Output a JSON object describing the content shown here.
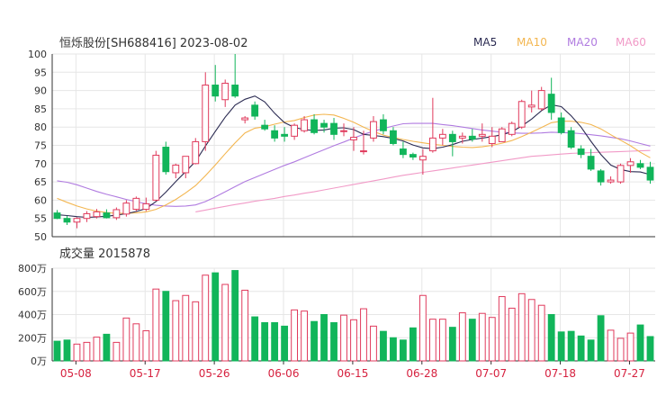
{
  "title": "恒烁股份[SH688416] 2023-08-02",
  "colors": {
    "up": "#e03a5c",
    "down": "#11b55a",
    "ma5": "#2b2b52",
    "ma10": "#f3b650",
    "ma20": "#b07be0",
    "ma60": "#f19ac7",
    "grid": "#e6e6e6",
    "axis_text": "#333333",
    "date_text": "#d6213f"
  },
  "legend": [
    {
      "name": "MA5",
      "color": "#2b2b52"
    },
    {
      "name": "MA10",
      "color": "#f3b650"
    },
    {
      "name": "MA20",
      "color": "#b07be0"
    },
    {
      "name": "MA60",
      "color": "#f19ac7"
    }
  ],
  "chart_data": [
    {
      "type": "candlestick",
      "yrange": [
        50,
        100
      ],
      "yticks": [
        "100",
        "95",
        "90",
        "85",
        "80",
        "75",
        "70",
        "65",
        "60",
        "55",
        "50"
      ],
      "x": [
        "05-08",
        "05-09",
        "05-10",
        "05-11",
        "05-12",
        "05-15",
        "05-16",
        "05-17",
        "05-18",
        "05-19",
        "05-22",
        "05-23",
        "05-24",
        "05-25",
        "05-26",
        "05-29",
        "05-30",
        "05-31",
        "06-01",
        "06-02",
        "06-05",
        "06-06",
        "06-07",
        "06-08",
        "06-09",
        "06-12",
        "06-13",
        "06-14",
        "06-15",
        "06-16",
        "06-19",
        "06-20",
        "06-21",
        "06-26",
        "06-27",
        "06-28",
        "06-29",
        "06-30",
        "07-03",
        "07-04",
        "07-05",
        "07-06",
        "07-07",
        "07-10",
        "07-11",
        "07-12",
        "07-13",
        "07-14",
        "07-17",
        "07-18",
        "07-19",
        "07-20",
        "07-21",
        "07-24",
        "07-25",
        "07-26",
        "07-27",
        "07-28",
        "07-31",
        "08-01",
        "08-02"
      ],
      "ohlc": [
        [
          56.5,
          57.3,
          54.8,
          55.0
        ],
        [
          55.0,
          55.7,
          53.2,
          54.0
        ],
        [
          54.0,
          55.3,
          52.3,
          55.0
        ],
        [
          55.0,
          57.0,
          54.0,
          56.3
        ],
        [
          55.5,
          57.6,
          55.0,
          56.8
        ],
        [
          56.5,
          57.5,
          55.0,
          55.2
        ],
        [
          55.2,
          58.0,
          54.6,
          57.4
        ],
        [
          56.2,
          60.0,
          55.5,
          59.2
        ],
        [
          57.5,
          61.0,
          57.0,
          60.5
        ],
        [
          57.5,
          60.7,
          57.0,
          59.0
        ],
        [
          60.0,
          73.5,
          59.7,
          72.3
        ],
        [
          74.5,
          76.0,
          67.0,
          67.8
        ],
        [
          67.5,
          70.0,
          66.0,
          69.6
        ],
        [
          67.5,
          72.0,
          66.0,
          72.0
        ],
        [
          70.0,
          77.0,
          69.8,
          76.0
        ],
        [
          76.0,
          95.0,
          73.5,
          91.5
        ],
        [
          91.5,
          97.0,
          87.0,
          88.5
        ],
        [
          87.5,
          93.0,
          85.5,
          92.0
        ],
        [
          91.5,
          100.0,
          88.0,
          88.5
        ],
        [
          82.0,
          83.0,
          81.0,
          82.5
        ],
        [
          86.0,
          87.0,
          82.0,
          83.0
        ],
        [
          80.5,
          82.0,
          79.0,
          79.5
        ],
        [
          79.0,
          80.5,
          76.0,
          77.0
        ],
        [
          78.0,
          80.0,
          76.0,
          77.5
        ],
        [
          77.5,
          81.0,
          76.5,
          80.5
        ],
        [
          79.0,
          83.0,
          78.5,
          82.0
        ],
        [
          82.0,
          83.5,
          78.0,
          78.5
        ],
        [
          81.0,
          82.0,
          78.5,
          80.0
        ],
        [
          81.0,
          82.5,
          76.5,
          78.0
        ],
        [
          79.0,
          81.0,
          77.5,
          79.0
        ],
        [
          76.5,
          80.0,
          73.5,
          77.2
        ],
        [
          73.5,
          79.0,
          72.5,
          73.5
        ],
        [
          77.0,
          83.0,
          76.0,
          81.5
        ],
        [
          82.0,
          83.5,
          78.0,
          79.0
        ],
        [
          79.0,
          80.0,
          75.0,
          75.5
        ],
        [
          74.0,
          76.0,
          71.5,
          72.5
        ],
        [
          72.5,
          73.0,
          71.0,
          71.8
        ],
        [
          71.0,
          74.0,
          67.0,
          72.0
        ],
        [
          73.5,
          88.0,
          73.0,
          77.0
        ],
        [
          77.0,
          79.5,
          75.0,
          78.0
        ],
        [
          78.0,
          79.0,
          72.0,
          76.0
        ],
        [
          77.0,
          78.5,
          75.5,
          77.5
        ],
        [
          77.5,
          79.5,
          76.0,
          76.7
        ],
        [
          77.5,
          81.0,
          76.0,
          78.0
        ],
        [
          75.5,
          80.0,
          74.5,
          77.5
        ],
        [
          76.0,
          80.0,
          76.0,
          79.5
        ],
        [
          78.0,
          81.5,
          77.5,
          81.0
        ],
        [
          80.0,
          87.5,
          79.5,
          87.0
        ],
        [
          85.5,
          90.0,
          84.0,
          86.0
        ],
        [
          85.0,
          91.0,
          84.5,
          90.0
        ],
        [
          89.0,
          93.5,
          82.0,
          84.0
        ],
        [
          82.5,
          84.0,
          78.0,
          78.5
        ],
        [
          79.0,
          80.0,
          74.0,
          74.5
        ],
        [
          74.0,
          75.0,
          71.5,
          72.5
        ],
        [
          72.0,
          74.0,
          68.0,
          68.5
        ],
        [
          68.0,
          68.5,
          64.0,
          65.0
        ],
        [
          65.0,
          66.5,
          64.5,
          65.5
        ],
        [
          65.0,
          70.0,
          64.5,
          69.5
        ],
        [
          69.5,
          71.5,
          67.5,
          70.5
        ],
        [
          70.0,
          71.0,
          68.5,
          69.0
        ],
        [
          69.0,
          70.5,
          64.5,
          65.5
        ]
      ],
      "ma5": [
        56.0,
        55.8,
        55.5,
        55.3,
        55.4,
        55.6,
        55.9,
        56.3,
        56.9,
        57.7,
        59.6,
        62.2,
        65.1,
        67.8,
        70.6,
        74.8,
        78.8,
        82.7,
        86.0,
        87.6,
        88.5,
        86.9,
        83.8,
        81.2,
        79.9,
        79.3,
        79.1,
        79.2,
        79.7,
        79.8,
        79.3,
        78.0,
        77.7,
        77.4,
        76.9,
        76.2,
        75.1,
        74.3,
        74.1,
        74.5,
        75.2,
        76.1,
        76.6,
        77.0,
        77.4,
        77.9,
        78.7,
        80.3,
        82.2,
        84.5,
        86.1,
        85.6,
        83.1,
        80.0,
        76.1,
        72.5,
        69.6,
        68.4,
        67.8,
        67.7,
        67.0
      ],
      "ma10": [
        60.5,
        59.4,
        58.4,
        57.6,
        57.0,
        56.6,
        56.4,
        56.4,
        56.5,
        56.8,
        57.5,
        58.7,
        60.2,
        62.0,
        64.0,
        66.7,
        69.6,
        72.7,
        75.7,
        78.4,
        79.7,
        80.1,
        80.8,
        81.4,
        81.8,
        82.6,
        83.3,
        83.5,
        83.3,
        82.4,
        81.3,
        80.0,
        78.8,
        77.8,
        77.2,
        76.6,
        76.1,
        75.7,
        75.3,
        75.0,
        74.7,
        74.5,
        74.4,
        74.6,
        75.0,
        75.6,
        76.3,
        77.4,
        78.6,
        79.9,
        81.2,
        81.6,
        81.6,
        81.3,
        80.7,
        79.5,
        77.9,
        76.4,
        74.9,
        73.1,
        71.6
      ],
      "ma20": [
        65.3,
        64.9,
        64.2,
        63.3,
        62.4,
        61.6,
        60.9,
        60.2,
        59.6,
        59.0,
        58.6,
        58.4,
        58.3,
        58.4,
        58.7,
        59.6,
        60.9,
        62.3,
        63.7,
        65.1,
        66.2,
        67.3,
        68.4,
        69.5,
        70.5,
        71.6,
        72.7,
        73.8,
        74.9,
        75.9,
        77.0,
        78.0,
        78.9,
        79.6,
        80.3,
        80.9,
        81.0,
        81.0,
        81.0,
        80.7,
        80.4,
        80.0,
        79.6,
        79.2,
        78.9,
        78.6,
        78.4,
        78.3,
        78.3,
        78.4,
        78.6,
        78.5,
        78.4,
        78.2,
        77.9,
        77.6,
        77.2,
        76.8,
        76.2,
        75.5,
        74.8
      ],
      "ma60": [
        null,
        null,
        null,
        null,
        null,
        null,
        null,
        null,
        null,
        null,
        null,
        null,
        null,
        null,
        56.8,
        57.3,
        57.8,
        58.3,
        58.8,
        59.2,
        59.7,
        60.1,
        60.5,
        61.0,
        61.4,
        61.9,
        62.3,
        62.8,
        63.3,
        63.8,
        64.3,
        64.8,
        65.3,
        65.8,
        66.3,
        66.8,
        67.2,
        67.6,
        68.0,
        68.4,
        68.8,
        69.2,
        69.6,
        70.0,
        70.4,
        70.8,
        71.2,
        71.6,
        72.0,
        72.2,
        72.4,
        72.6,
        72.8,
        72.9,
        73.0,
        73.1,
        73.2,
        73.3,
        73.4,
        73.5,
        73.6
      ]
    },
    {
      "type": "bar",
      "label": "成交量",
      "latest_value": "2015878",
      "yrange": [
        0,
        800
      ],
      "yticks": [
        "800万",
        "600万",
        "400万",
        "200万",
        "0万"
      ],
      "values": [
        170,
        180,
        145,
        160,
        205,
        230,
        160,
        370,
        320,
        260,
        620,
        600,
        520,
        565,
        510,
        740,
        760,
        660,
        780,
        610,
        380,
        330,
        330,
        300,
        440,
        430,
        340,
        400,
        330,
        395,
        355,
        450,
        300,
        255,
        200,
        180,
        285,
        565,
        360,
        360,
        290,
        415,
        360,
        410,
        375,
        555,
        455,
        580,
        530,
        480,
        400,
        250,
        255,
        215,
        180,
        390,
        265,
        195,
        240,
        310,
        210
      ]
    }
  ],
  "date_labels": [
    {
      "label": "05-08",
      "index": 0
    },
    {
      "label": "05-17",
      "index": 7
    },
    {
      "label": "05-26",
      "index": 14
    },
    {
      "label": "06-06",
      "index": 21
    },
    {
      "label": "06-15",
      "index": 28
    },
    {
      "label": "06-28",
      "index": 35
    },
    {
      "label": "07-07",
      "index": 42
    },
    {
      "label": "07-18",
      "index": 49
    },
    {
      "label": "07-27",
      "index": 56
    }
  ]
}
